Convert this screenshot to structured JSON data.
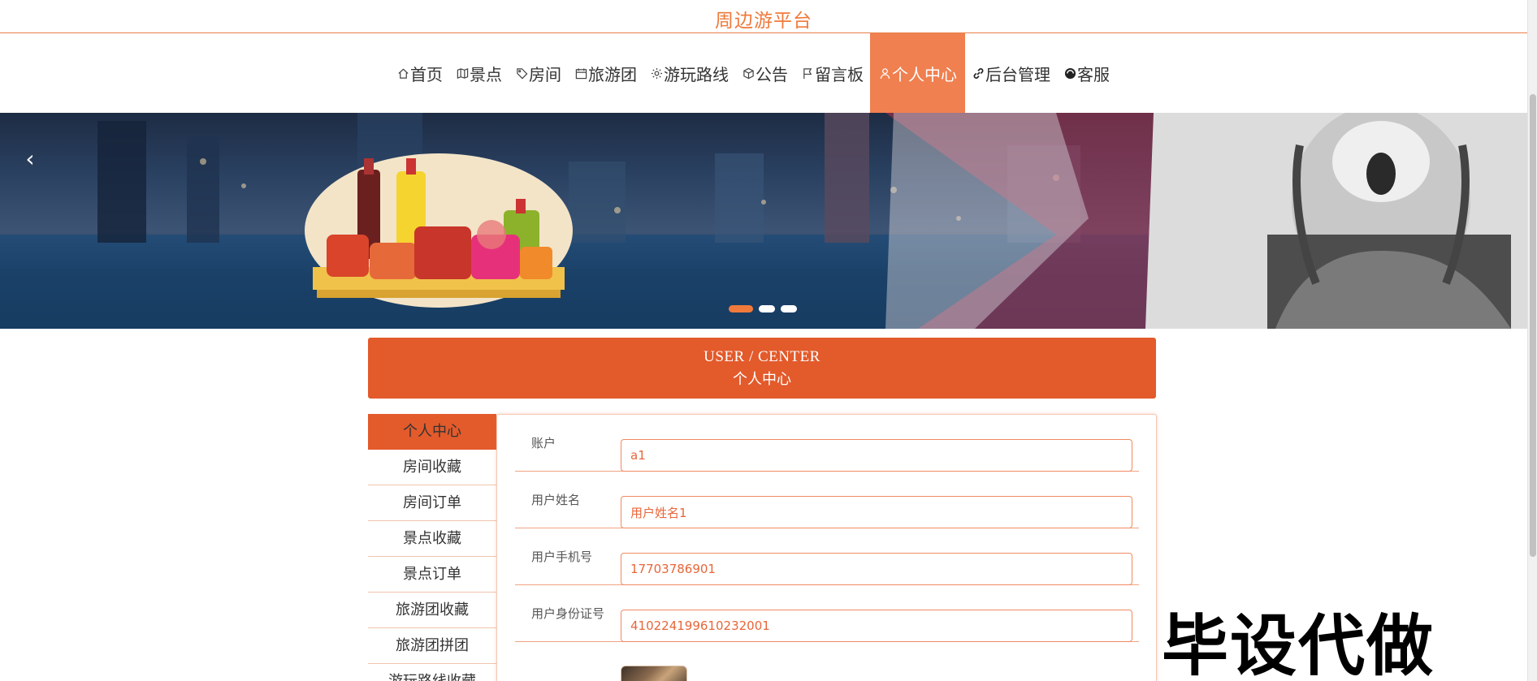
{
  "site": {
    "title": "周边游平台",
    "accent_color": "#f07a3c",
    "header_color": "#e35a2b"
  },
  "nav": {
    "items": [
      {
        "label": "首页",
        "icon": "home-icon"
      },
      {
        "label": "景点",
        "icon": "map-icon"
      },
      {
        "label": "房间",
        "icon": "tag-icon"
      },
      {
        "label": "旅游团",
        "icon": "calendar-icon"
      },
      {
        "label": "游玩路线",
        "icon": "gear-icon"
      },
      {
        "label": "公告",
        "icon": "cube-icon"
      },
      {
        "label": "留言板",
        "icon": "flag-icon"
      },
      {
        "label": "个人中心",
        "icon": "user-icon",
        "active": true
      },
      {
        "label": "后台管理",
        "icon": "link-icon"
      },
      {
        "label": "客服",
        "icon": "chat-icon"
      }
    ]
  },
  "banner": {
    "prev_arrow": "‹",
    "slide_count": 3,
    "active_slide": 0
  },
  "user_center": {
    "title_en": "USER / CENTER",
    "title_cn": "个人中心"
  },
  "side_menu": {
    "items": [
      {
        "label": "个人中心",
        "active": true
      },
      {
        "label": "房间收藏"
      },
      {
        "label": "房间订单"
      },
      {
        "label": "景点收藏"
      },
      {
        "label": "景点订单"
      },
      {
        "label": "旅游团收藏"
      },
      {
        "label": "旅游团拼团"
      },
      {
        "label": "游玩路线收藏"
      }
    ]
  },
  "form": {
    "account_label": "账户",
    "account_value": "a1",
    "name_label": "用户姓名",
    "name_value": "用户姓名1",
    "phone_label": "用户手机号",
    "phone_value": "17703786901",
    "id_label": "用户身份证号",
    "id_value": "410224199610232001"
  },
  "watermark": {
    "text": "毕设代做"
  }
}
